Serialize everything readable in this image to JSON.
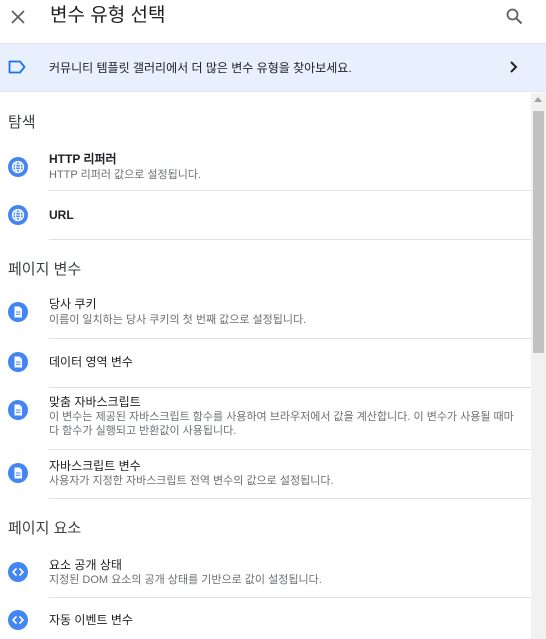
{
  "header": {
    "title": "변수 유형 선택",
    "close_icon": "close-icon",
    "search_icon": "search-icon"
  },
  "banner": {
    "text": "커뮤니티 템플릿 갤러리에서 더 많은 변수 유형을 찾아보세요.",
    "icon": "tag-icon",
    "chevron": "chevron-right-icon",
    "background": "#e8f0fe"
  },
  "sections": {
    "navigation": {
      "title": "탐색",
      "items": [
        {
          "title": "HTTP 리퍼러",
          "desc": "HTTP 리퍼러 값으로 설정됩니다.",
          "icon": "globe-icon"
        },
        {
          "title": "URL",
          "desc": "",
          "icon": "globe-icon"
        }
      ]
    },
    "page_variables": {
      "title": "페이지 변수",
      "items": [
        {
          "title": "당사 쿠키",
          "desc": "이름이 일치하는 당사 쿠키의 첫 번째 값으로 설정됩니다.",
          "icon": "document-icon"
        },
        {
          "title": "데이터 영역 변수",
          "desc": "",
          "icon": "document-icon"
        },
        {
          "title": "맞춤 자바스크립트",
          "desc": "이 변수는 제공된 자바스크립트 함수를 사용하여 브라우저에서 값을 계산합니다. 이 변수가 사용될 때마다 함수가 실행되고 반환값이 사용됩니다.",
          "icon": "document-icon"
        },
        {
          "title": "자바스크립트 변수",
          "desc": "사용자가 지정한 자바스크립트 전역 변수의 값으로 설정됩니다.",
          "icon": "document-icon"
        }
      ]
    },
    "page_elements": {
      "title": "페이지 요소",
      "items": [
        {
          "title": "요소 공개 상태",
          "desc": "지정된 DOM 요소의 공개 상태를 기반으로 값이 설정됩니다.",
          "icon": "code-icon"
        },
        {
          "title": "자동 이벤트 변수",
          "desc": "",
          "icon": "code-icon"
        }
      ]
    }
  },
  "colors": {
    "accent": "#4285f4",
    "divider": "#e0e0e0"
  }
}
